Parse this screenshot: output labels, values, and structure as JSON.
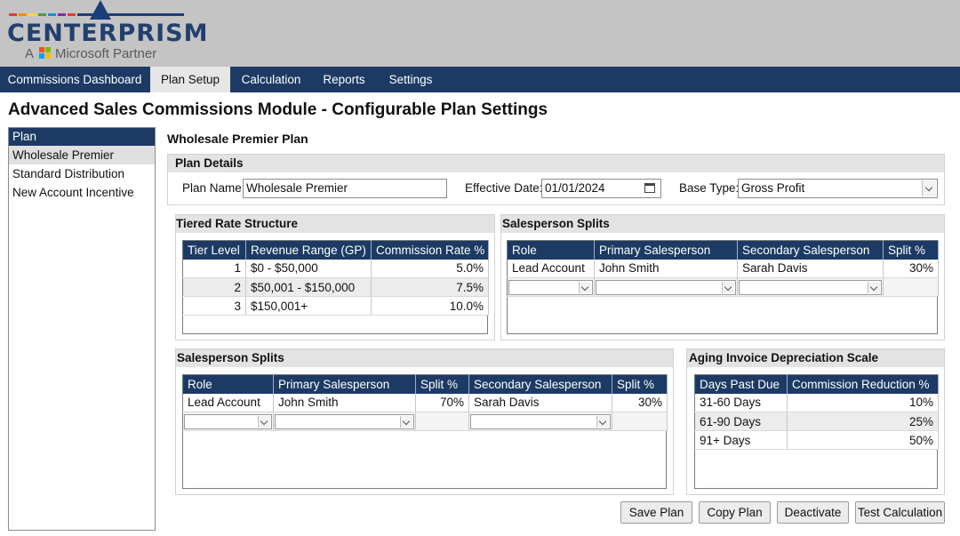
{
  "header": {
    "logo_text": "CENTERPRISM",
    "logo_sub_prefix": "A",
    "logo_sub_suffix": "Microsoft Partner",
    "colors": {
      "bar": "#1c3a64",
      "logo_text": "#22406f"
    }
  },
  "nav": {
    "items": [
      {
        "label": "Commissions Dashboard",
        "active": false
      },
      {
        "label": "Plan Setup",
        "active": true
      },
      {
        "label": "Calculation",
        "active": false
      },
      {
        "label": "Reports",
        "active": false
      },
      {
        "label": "Settings",
        "active": false
      }
    ]
  },
  "page": {
    "title": "Advanced Sales Commissions Module - Configurable Plan Settings"
  },
  "plan_list": {
    "header": "Plan",
    "items": [
      "Wholesale Premier",
      "Standard Distribution",
      "New Account Incentive"
    ],
    "selected": "Wholesale Premier"
  },
  "plan": {
    "title": "Wholesale Premier Plan",
    "details": {
      "heading": "Plan Details",
      "name_label": "Plan Name:",
      "name_value": "Wholesale Premier",
      "date_label": "Effective Date:",
      "date_value": "01/01/2024",
      "base_label": "Base Type:",
      "base_value": "Gross Profit"
    },
    "tiers": {
      "heading": "Tiered Rate Structure",
      "columns": [
        "Tier Level",
        "Revenue Range (GP)",
        "Commission Rate %"
      ],
      "rows": [
        [
          "1",
          "$0 - $50,000",
          "5.0%"
        ],
        [
          "2",
          "$50,001 - $150,000",
          "7.5%"
        ],
        [
          "3",
          "$150,001+",
          "10.0%"
        ]
      ]
    },
    "splits_top": {
      "heading": "Salesperson Splits",
      "columns": [
        "Role",
        "Primary Salesperson",
        "Secondary Salesperson",
        "Split %"
      ],
      "rows": [
        [
          "Lead Account",
          "John Smith",
          "Sarah Davis",
          "30%"
        ]
      ]
    },
    "splits_bottom": {
      "heading": "Salesperson Splits",
      "columns": [
        "Role",
        "Primary Salesperson",
        "Split %",
        "Secondary Salesperson",
        "Split %"
      ],
      "rows": [
        [
          "Lead Account",
          "John Smith",
          "70%",
          "Sarah Davis",
          "30%"
        ]
      ]
    },
    "aging": {
      "heading": "Aging Invoice Depreciation Scale",
      "columns": [
        "Days Past Due",
        "Commission Reduction %"
      ],
      "rows": [
        [
          "31-60 Days",
          "10%"
        ],
        [
          "61-90 Days",
          "25%"
        ],
        [
          "91+ Days",
          "50%"
        ]
      ]
    }
  },
  "actions": {
    "save": "Save Plan",
    "copy": "Copy Plan",
    "deactivate": "Deactivate",
    "test": "Test Calculation"
  }
}
